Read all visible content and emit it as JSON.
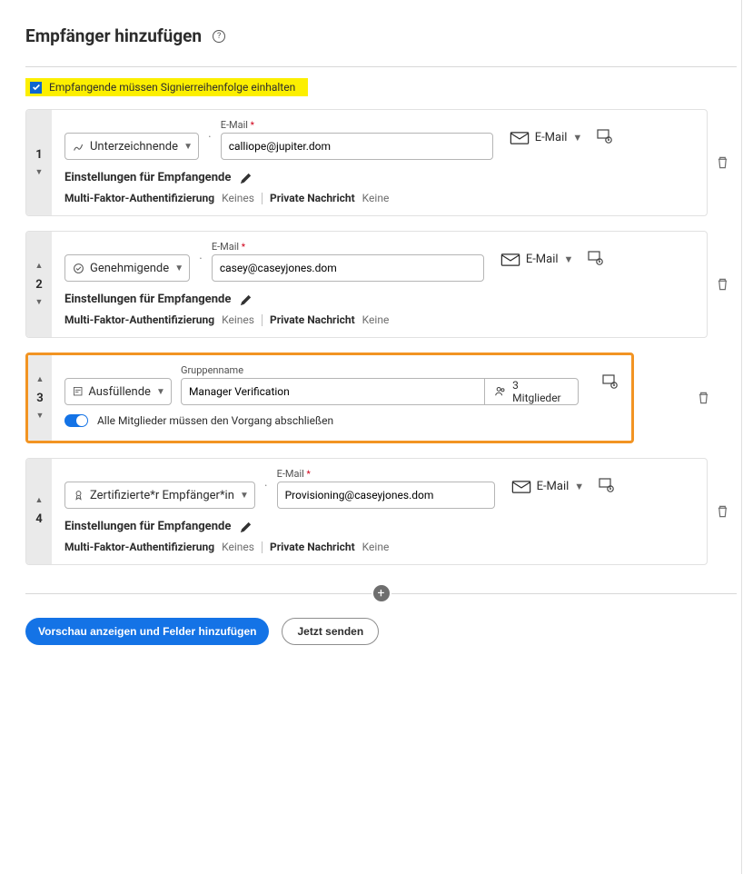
{
  "page": {
    "title": "Empfänger hinzufügen",
    "order_checkbox_label": "Empfangende müssen Signierreihenfolge einhalten",
    "preview_button": "Vorschau anzeigen und Felder hinzufügen",
    "send_now_button": "Jetzt senden"
  },
  "common": {
    "email_label": "E-Mail",
    "group_label": "Gruppenname",
    "delivery_email": "E-Mail",
    "settings_heading": "Einstellungen für Empfangende",
    "mfa_label": "Multi-Faktor-Authentifizierung",
    "mfa_value": "Keines",
    "pm_label": "Private Nachricht",
    "pm_value": "Keine"
  },
  "roles": {
    "signer": "Unterzeichnende",
    "approver": "Genehmigende",
    "filler": "Ausfüllende",
    "certified": "Zertifizierte*r Empfänger*in"
  },
  "recipients": [
    {
      "index": "1",
      "role": "Unterzeichnende",
      "email": "calliope@jupiter.dom"
    },
    {
      "index": "2",
      "role": "Genehmigende",
      "email": "casey@caseyjones.dom"
    },
    {
      "index": "3",
      "role": "Ausfüllende",
      "group_name": "Manager Verification",
      "members": "3 Mitglieder",
      "toggle_label": "Alle Mitglieder müssen den Vorgang abschließen"
    },
    {
      "index": "4",
      "role": "Zertifizierte*r Empfänger*in",
      "email": "Provisioning@caseyjones.dom"
    }
  ]
}
